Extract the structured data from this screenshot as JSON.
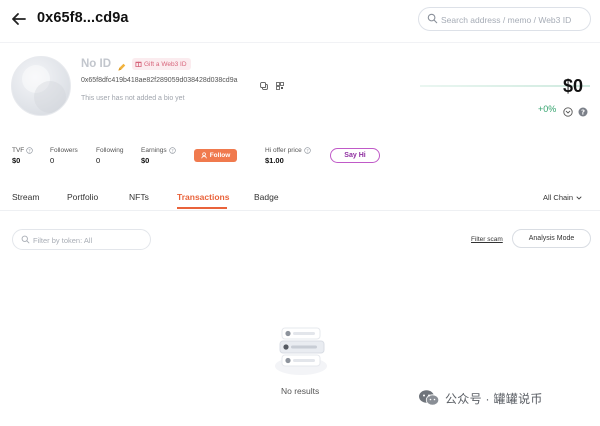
{
  "header": {
    "title": "0x65f8...cd9a",
    "search_placeholder": "Search address / memo / Web3 ID"
  },
  "profile": {
    "name": "No ID",
    "gift_label": "Gift a Web3 ID",
    "address": "0x65f8dfc419b418ae82f289059d038428d038cd9a",
    "bio": "This user has not added a bio yet"
  },
  "balance": {
    "value": "$0",
    "change": "+0%"
  },
  "stats": {
    "tvf_label": "TVF",
    "tvf_value": "$0",
    "followers_label": "Followers",
    "followers_value": "0",
    "following_label": "Following",
    "following_value": "0",
    "earnings_label": "Earnings",
    "earnings_value": "$0",
    "follow_button": "Follow",
    "hi_offer_label": "Hi offer price",
    "hi_offer_value": "$1.00",
    "say_hi_button": "Say Hi"
  },
  "tabs": {
    "items": [
      {
        "label": "Stream"
      },
      {
        "label": "Portfolio"
      },
      {
        "label": "NFTs"
      },
      {
        "label": "Transactions"
      },
      {
        "label": "Badge"
      }
    ],
    "active": "Transactions",
    "chain_selector": "All Chain"
  },
  "filters": {
    "token_placeholder": "Filter by token: All",
    "filter_scam": "Filter scam",
    "analysis_mode": "Analysis Mode"
  },
  "empty_state": {
    "text": "No results"
  },
  "watermark": {
    "text": "公众号 · 罐罐说币"
  },
  "colors": {
    "accent": "#e9633b",
    "follow": "#f07a4e",
    "say_hi": "#c05ac8",
    "positive": "#33a36d"
  }
}
